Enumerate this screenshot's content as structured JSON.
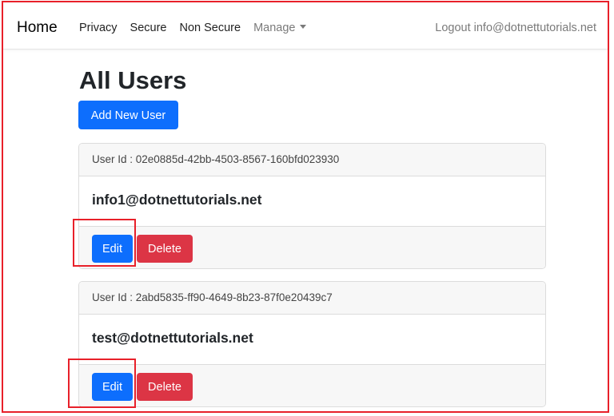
{
  "navbar": {
    "brand": "Home",
    "links": [
      "Privacy",
      "Secure",
      "Non Secure",
      "Manage"
    ],
    "logout": "Logout info@dotnettutorials.net"
  },
  "page": {
    "title": "All Users",
    "add_button": "Add New User"
  },
  "users": [
    {
      "id_line": "User Id : 02e0885d-42bb-4503-8567-160bfd023930",
      "email": "info1@dotnettutorials.net",
      "edit_label": "Edit",
      "delete_label": "Delete"
    },
    {
      "id_line": "User Id : 2abd5835-ff90-4649-8b23-87f0e20439c7",
      "email": "test@dotnettutorials.net",
      "edit_label": "Edit",
      "delete_label": "Delete"
    }
  ],
  "colors": {
    "primary": "#0d6efd",
    "danger": "#dc3545",
    "highlight": "#e8202a"
  }
}
